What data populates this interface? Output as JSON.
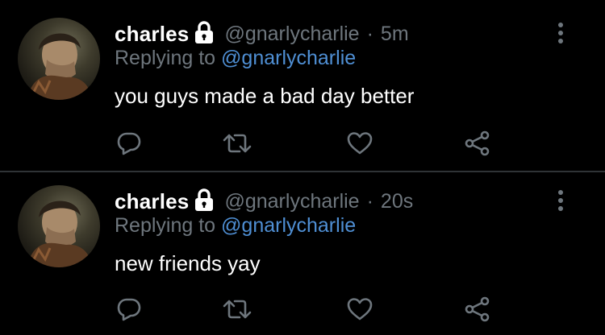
{
  "colors": {
    "background": "#000000",
    "text": "#ffffff",
    "secondary": "#6e767d",
    "mention": "#4f8fd4",
    "divider": "#2f3336"
  },
  "icons": {
    "lock": "lock-icon",
    "more": "more-vertical-icon",
    "reply": "reply-icon",
    "retweet": "retweet-icon",
    "like": "heart-icon",
    "share": "share-icon"
  },
  "tweets": [
    {
      "name": "charles",
      "handle": "@gnarlycharlie",
      "separator": "·",
      "time": "5m",
      "replying_prefix": "Replying to",
      "replying_to": "@gnarlycharlie",
      "text": "you guys made a bad day better"
    },
    {
      "name": "charles",
      "handle": "@gnarlycharlie",
      "separator": "·",
      "time": "20s",
      "replying_prefix": "Replying to",
      "replying_to": "@gnarlycharlie",
      "text": "new friends yay"
    }
  ]
}
